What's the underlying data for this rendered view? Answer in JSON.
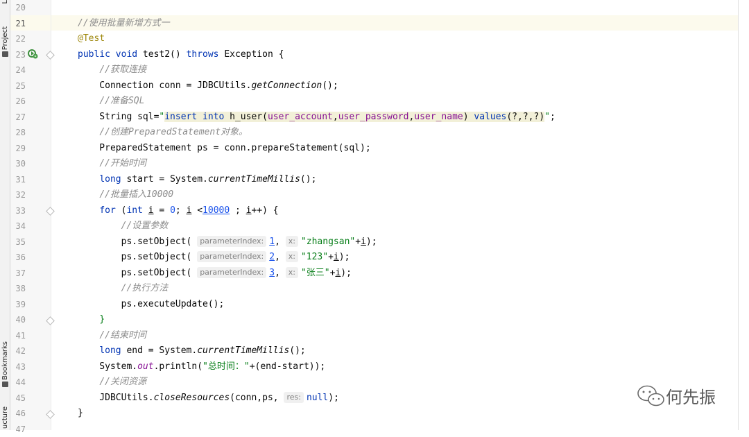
{
  "sidebar": {
    "top_tab_fragment": "L",
    "project_tab": "Project",
    "bookmarks_tab": "Bookmarks",
    "structure_tab": "ucture"
  },
  "editor": {
    "lines": [
      {
        "n": "20",
        "html": ""
      },
      {
        "n": "21",
        "html": "<span class='cmt'>//使用批量新增方式一</span>"
      },
      {
        "n": "22",
        "html": "<span class='ann'>@Test</span>"
      },
      {
        "n": "23",
        "html": "<span class='kw'>public void</span> test2() <span class='kw'>throws</span> Exception {"
      },
      {
        "n": "24",
        "html": "    <span class='cmt'>//获取连接</span>"
      },
      {
        "n": "25",
        "html": "    Connection conn = JDBCUtils.<span class='it'>getConnection</span>();"
      },
      {
        "n": "26",
        "html": "    <span class='cmt'>//准备SQL</span>"
      },
      {
        "n": "27",
        "html": "    String sql=<span class='str'>\"</span><span class='sqlbg'><span class='sqlkw'>insert into</span> h_user(<span class='sqlcol'>user_account</span>,<span class='sqlcol'>user_password</span>,<span class='sqlcol'>user_name</span>) <span class='sqlkw'>values</span>(?,?,?)</span><span class='str'>\"</span>;"
      },
      {
        "n": "28",
        "html": "    <span class='cmt'>//创建PreparedStatement对象。</span>"
      },
      {
        "n": "29",
        "html": "    PreparedStatement ps = conn.prepareStatement(sql);"
      },
      {
        "n": "30",
        "html": "    <span class='cmt'>//开始时间</span>"
      },
      {
        "n": "31",
        "html": "    <span class='kw'>long</span> start = System.<span class='it'>currentTimeMillis</span>();"
      },
      {
        "n": "32",
        "html": "    <span class='cmt'>//批量插入10000</span>"
      },
      {
        "n": "33",
        "html": "    <span class='kw'>for</span> (<span class='kw'>int</span> <span class='ul'>i</span> = <span class='num'>0</span>; <span class='ul'>i</span> &lt;<span class='num ul'>10000</span> ; <span class='ul'>i</span>++) {"
      },
      {
        "n": "34",
        "html": "        <span class='cmt'>//设置参数</span>"
      },
      {
        "n": "35",
        "html": "        ps.setObject( <span class='hint'>parameterIndex:</span><span class='num ul'>1</span>, <span class='hint'>x:</span><span class='str'>\"zhangsan\"</span>+<span class='ul'>i</span>);"
      },
      {
        "n": "36",
        "html": "        ps.setObject( <span class='hint'>parameterIndex:</span><span class='num ul'>2</span>, <span class='hint'>x:</span><span class='str'>\"123\"</span>+<span class='ul'>i</span>);"
      },
      {
        "n": "37",
        "html": "        ps.setObject( <span class='hint'>parameterIndex:</span><span class='num ul'>3</span>, <span class='hint'>x:</span><span class='str'>\"张三\"</span>+<span class='ul'>i</span>);"
      },
      {
        "n": "38",
        "html": "        <span class='cmt'>//执行方法</span>"
      },
      {
        "n": "39",
        "html": "        ps.executeUpdate();"
      },
      {
        "n": "40",
        "html": "    <span class='str'>}</span>"
      },
      {
        "n": "41",
        "html": "    <span class='cmt'>//结束时间</span>"
      },
      {
        "n": "42",
        "html": "    <span class='kw'>long</span> end = System.<span class='it'>currentTimeMillis</span>();"
      },
      {
        "n": "43",
        "html": "    System.<span class='fld'>out</span>.println(<span class='str'>\"总时间：\"</span>+(end-start));"
      },
      {
        "n": "44",
        "html": "    <span class='cmt'>//关闭资源</span>"
      },
      {
        "n": "45",
        "html": "    JDBCUtils.<span class='it'>closeResources</span>(conn,ps, <span class='hint'>res:</span><span class='kw'>null</span>);"
      },
      {
        "n": "46",
        "html": "}"
      },
      {
        "n": "47",
        "html": ""
      }
    ]
  },
  "watermark": {
    "text": "何先振",
    "icon": "wechat-icon"
  }
}
